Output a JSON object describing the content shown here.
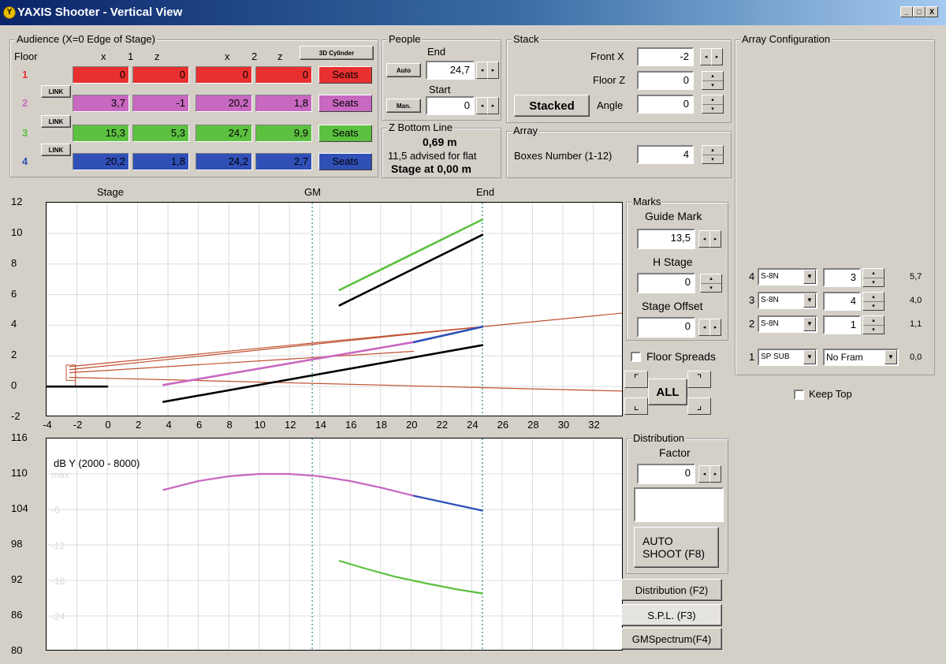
{
  "window": {
    "title": "YAXIS Shooter - Vertical View",
    "icon": "yaxis-logo-icon",
    "buttons": [
      "_",
      "□",
      "X"
    ]
  },
  "audience": {
    "group_label": "Audience (X=0 Edge of Stage)",
    "floor_label": "Floor",
    "col_x1": "x",
    "col_1": "1",
    "col_z1": "z",
    "col_x2": "x",
    "col_2": "2",
    "col_z2": "z",
    "sideview_label": "3D Cylinder",
    "link_label": "LINK",
    "seats_label": "Seats",
    "floors": [
      {
        "num": "1",
        "color": "#e83030",
        "x1": "0",
        "z1": "0",
        "x2": "0",
        "z2": "0"
      },
      {
        "num": "2",
        "color": "#c868c0",
        "x1": "3,7",
        "z1": "-1",
        "x2": "20,2",
        "z2": "1,8"
      },
      {
        "num": "3",
        "color": "#5cc040",
        "x1": "15,3",
        "z1": "5,3",
        "x2": "24,7",
        "z2": "9,9"
      },
      {
        "num": "4",
        "color": "#3050b8",
        "x1": "20,2",
        "z1": "1,8",
        "x2": "24,2",
        "z2": "2,7"
      }
    ]
  },
  "people": {
    "group_label": "People",
    "end_label": "End",
    "auto_label": "Auto",
    "end_value": "24,7",
    "start_label": "Start",
    "man_label": "Man.",
    "start_value": "0"
  },
  "zbottom": {
    "group_label": "Z Bottom Line",
    "value": "0,69 m",
    "advice": "11,5 advised for flat",
    "stage": "Stage at 0,00 m"
  },
  "stack": {
    "group_label": "Stack",
    "front_x_label": "Front X",
    "front_x_value": "-2",
    "floor_z_label": "Floor Z",
    "floor_z_value": "0",
    "angle_label": "Angle",
    "angle_value": "0",
    "stacked_label": "Stacked"
  },
  "array": {
    "group_label": "Array",
    "boxes_label": "Boxes Number (1-12)",
    "boxes_value": "4"
  },
  "array_config": {
    "group_label": "Array Configuration",
    "rows": [
      {
        "num": "4",
        "type": "S-8N",
        "value": "3",
        "angle": "5,7"
      },
      {
        "num": "3",
        "type": "S-8N",
        "value": "4",
        "angle": "4,0"
      },
      {
        "num": "2",
        "type": "S-8N",
        "value": "1",
        "angle": "1,1"
      },
      {
        "num": "1",
        "type": "SP SUB",
        "value": "No Fram",
        "angle": "0,0"
      }
    ],
    "keep_top_label": "Keep Top"
  },
  "marks": {
    "group_label": "Marks",
    "guide_label": "Guide Mark",
    "guide_value": "13,5",
    "hstage_label": "H Stage",
    "hstage_value": "0",
    "offset_label": "Stage Offset",
    "offset_value": "0",
    "floor_spreads_label": "Floor Spreads",
    "all_label": "ALL"
  },
  "distribution": {
    "group_label": "Distribution",
    "factor_label": "Factor",
    "factor_value": "0",
    "auto_shoot_line1": "AUTO",
    "auto_shoot_line2": "SHOOT (F8)",
    "tab_distribution": "Distribution (F2)",
    "tab_spl": "S.P.L. (F3)",
    "tab_gm": "GMSpectrum(F4)"
  },
  "plot_top": {
    "marker_stage": "Stage",
    "marker_gm": "GM",
    "marker_end": "End",
    "y_ticks": [
      "12",
      "10",
      "8",
      "6",
      "4",
      "2",
      "0",
      "-2"
    ],
    "x_ticks": [
      "-4",
      "-2",
      "0",
      "2",
      "4",
      "6",
      "8",
      "10",
      "12",
      "14",
      "16",
      "18",
      "20",
      "22",
      "24",
      "26",
      "28",
      "30",
      "32"
    ]
  },
  "plot_bottom": {
    "label": "dB Y (2000 - 8000)",
    "y_ticks": [
      "116",
      "110",
      "104",
      "98",
      "92",
      "86",
      "80"
    ],
    "faint_labels": [
      "max",
      "-6",
      "-12",
      "-18",
      "-24"
    ]
  },
  "chart_data": [
    {
      "type": "line",
      "title": "",
      "xlabel": "",
      "ylabel": "",
      "xlim": [
        -4,
        34
      ],
      "ylim": [
        -2,
        12
      ],
      "grid": true,
      "markers": {
        "Stage": 0,
        "GM": 13.5,
        "End": 24.7
      },
      "series": [
        {
          "color": "#5cc040",
          "points": [
            [
              15.3,
              6.3
            ],
            [
              24.7,
              10.9
            ]
          ]
        },
        {
          "color": "#000000",
          "points": [
            [
              15.3,
              5.3
            ],
            [
              24.7,
              9.9
            ]
          ]
        },
        {
          "color": "#c868c0",
          "points": [
            [
              3.7,
              0.1
            ],
            [
              20.2,
              2.9
            ]
          ]
        },
        {
          "color": "#3050b8",
          "points": [
            [
              20.2,
              2.9
            ],
            [
              24.7,
              3.9
            ]
          ]
        },
        {
          "color": "#000000",
          "points": [
            [
              3.7,
              -1.0
            ],
            [
              24.7,
              2.7
            ]
          ]
        },
        {
          "color": "#000000",
          "points": [
            [
              -4,
              0
            ],
            [
              -2,
              0
            ],
            [
              0,
              0
            ]
          ]
        }
      ]
    },
    {
      "type": "line",
      "title": "dB Y (2000 - 8000)",
      "xlim": [
        -4,
        34
      ],
      "ylim": [
        80,
        116
      ],
      "grid": true,
      "series": [
        {
          "color": "#c868c0",
          "points": [
            [
              3.7,
              107.3
            ],
            [
              6,
              108.8
            ],
            [
              8,
              109.6
            ],
            [
              10,
              110.0
            ],
            [
              12,
              110.0
            ],
            [
              14,
              109.6
            ],
            [
              16,
              108.8
            ],
            [
              18,
              107.7
            ],
            [
              20.2,
              106.3
            ]
          ]
        },
        {
          "color": "#3050b8",
          "points": [
            [
              20.2,
              106.3
            ],
            [
              22,
              105.3
            ],
            [
              24.7,
              103.8
            ]
          ]
        },
        {
          "color": "#5cc040",
          "points": [
            [
              15.3,
              95.3
            ],
            [
              17,
              94.0
            ],
            [
              19,
              92.6
            ],
            [
              21,
              91.5
            ],
            [
              23,
              90.5
            ],
            [
              24.7,
              89.8
            ]
          ]
        }
      ]
    }
  ]
}
